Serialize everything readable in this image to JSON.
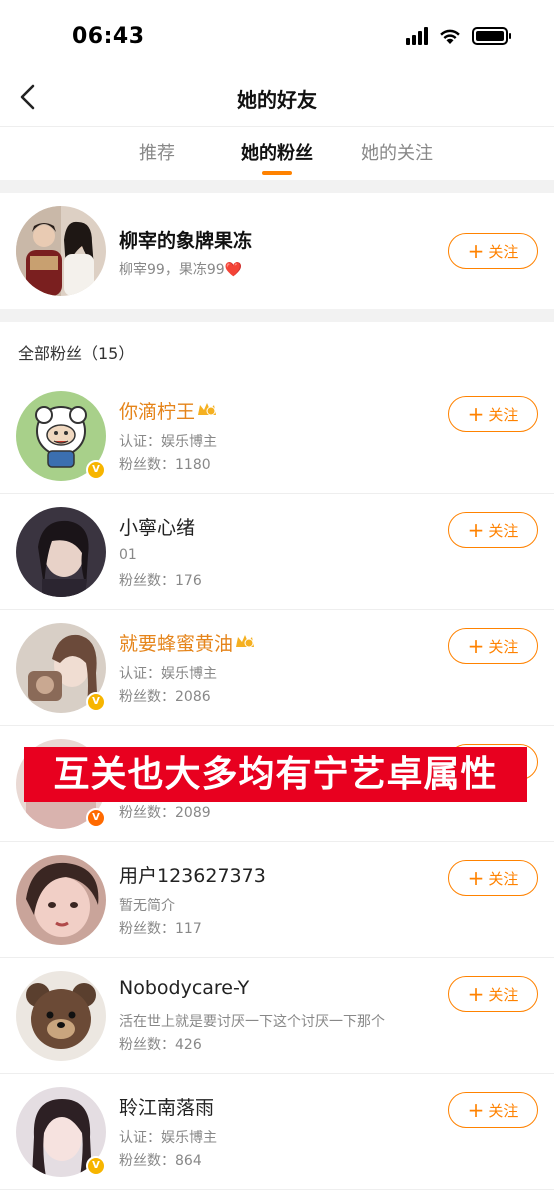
{
  "status_bar": {
    "time": "06:43"
  },
  "nav": {
    "title": "她的好友"
  },
  "tabs": [
    {
      "label": "推荐",
      "active": false
    },
    {
      "label": "她的粉丝",
      "active": true
    },
    {
      "label": "她的关注",
      "active": false
    }
  ],
  "featured": {
    "name": "柳宰的象牌果冻",
    "subtitle": "柳宰99，果冻99",
    "heart": "❤️",
    "follow_label": "关注"
  },
  "section_title": "全部粉丝（15）",
  "fans": [
    {
      "name": "你滴柠王",
      "desc": "认证：娱乐博主",
      "count": "粉丝数：1180",
      "follow_label": "关注"
    },
    {
      "name": "小寧心绪",
      "desc": "01",
      "count": "粉丝数：176",
      "follow_label": "关注"
    },
    {
      "name": "就要蜂蜜黄油",
      "desc": "认证：娱乐博主",
      "count": "粉丝数：2086",
      "follow_label": "关注"
    },
    {
      "name": "",
      "desc": "",
      "count": "粉丝数：2089",
      "follow_label": "关注"
    },
    {
      "name": "用户123627373",
      "desc": "暂无简介",
      "count": "粉丝数：117",
      "follow_label": "关注"
    },
    {
      "name": "Nobodycare-Y",
      "desc": "活在世上就是要讨厌一下这个讨厌一下那个",
      "count": "粉丝数：426",
      "follow_label": "关注"
    },
    {
      "name": "聆江南落雨",
      "desc": "认证：娱乐博主",
      "count": "粉丝数：864",
      "follow_label": "关注"
    }
  ],
  "overlay_caption": "互关也大多均有宁艺卓属性",
  "colors": {
    "accent": "#ff8200",
    "gold_name": "#e5841a",
    "overlay_bg": "#e8001f",
    "divider": "#f2f2f2"
  }
}
